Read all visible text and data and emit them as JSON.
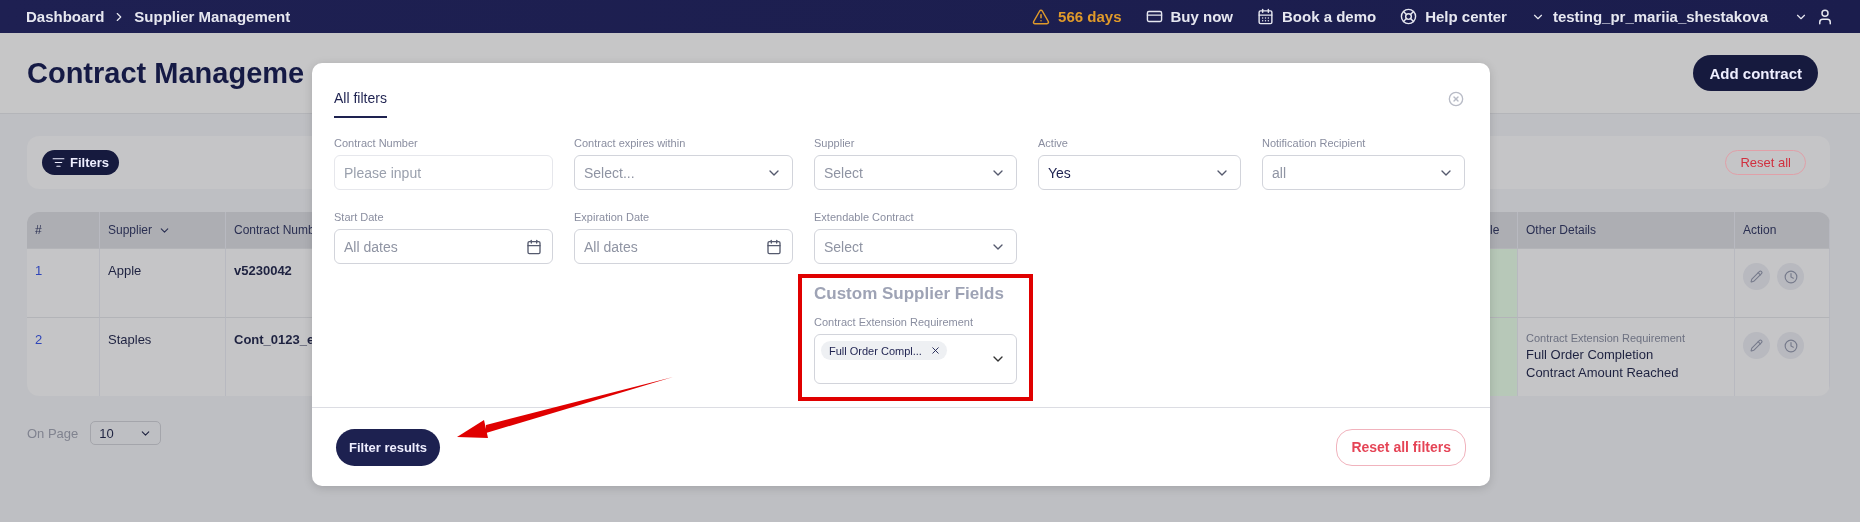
{
  "top_bar": {
    "breadcrumbs": [
      "Dashboard",
      "Supplier Management"
    ],
    "trial": "566 days",
    "links": [
      "Buy now",
      "Book a demo",
      "Help center"
    ],
    "user": "testing_pr_mariia_shestakova"
  },
  "header": {
    "title": "Contract Manageme",
    "add_button": "Add contract"
  },
  "filter_bar": {
    "filters_button": "Filters",
    "reset_button": "Reset all"
  },
  "table": {
    "columns": [
      {
        "label": "#",
        "sortable": false
      },
      {
        "label": "Supplier",
        "sortable": true
      },
      {
        "label": "Contract Numb"
      },
      {
        "label": "le",
        "sortable": false
      },
      {
        "label": "Other Details",
        "sortable": false
      },
      {
        "label": "Action",
        "sortable": false
      }
    ],
    "rows": [
      {
        "number": "1",
        "supplier": "Apple",
        "contract_number": "v5230042"
      },
      {
        "number": "2",
        "supplier": "Staples",
        "contract_number": "Cont_0123_e",
        "other_details": {
          "label": "Contract Extension Requirement",
          "values": [
            "Full Order Completion",
            "Contract Amount Reached"
          ]
        }
      }
    ]
  },
  "pagination": {
    "label": "On Page",
    "value": "10"
  },
  "modal": {
    "tabs": [
      {
        "label": "All filters",
        "selected": true
      }
    ],
    "fields": [
      {
        "kind": "text",
        "label": "Contract Number",
        "placeholder": "Please input"
      },
      {
        "kind": "select",
        "label": "Contract expires within",
        "placeholder": "Select..."
      },
      {
        "kind": "select",
        "label": "Supplier",
        "placeholder": "Select"
      },
      {
        "kind": "select",
        "label": "Active",
        "value": "Yes"
      },
      {
        "kind": "select",
        "label": "Notification Recipient",
        "placeholder": "all"
      },
      {
        "kind": "date",
        "label": "Start Date",
        "placeholder": "All dates"
      },
      {
        "kind": "date",
        "label": "Expiration Date",
        "placeholder": "All dates"
      },
      {
        "kind": "select",
        "label": "Extendable Contract",
        "placeholder": "Select"
      }
    ],
    "custom_section": {
      "title": "Custom Supplier Fields",
      "highlighted": true,
      "field": {
        "label": "Contract Extension Requirement",
        "chips": [
          "Full Order Compl..."
        ]
      }
    },
    "submit_button": "Filter results",
    "reset_button": "Reset all filters"
  },
  "annotation": {
    "arrow": true
  }
}
